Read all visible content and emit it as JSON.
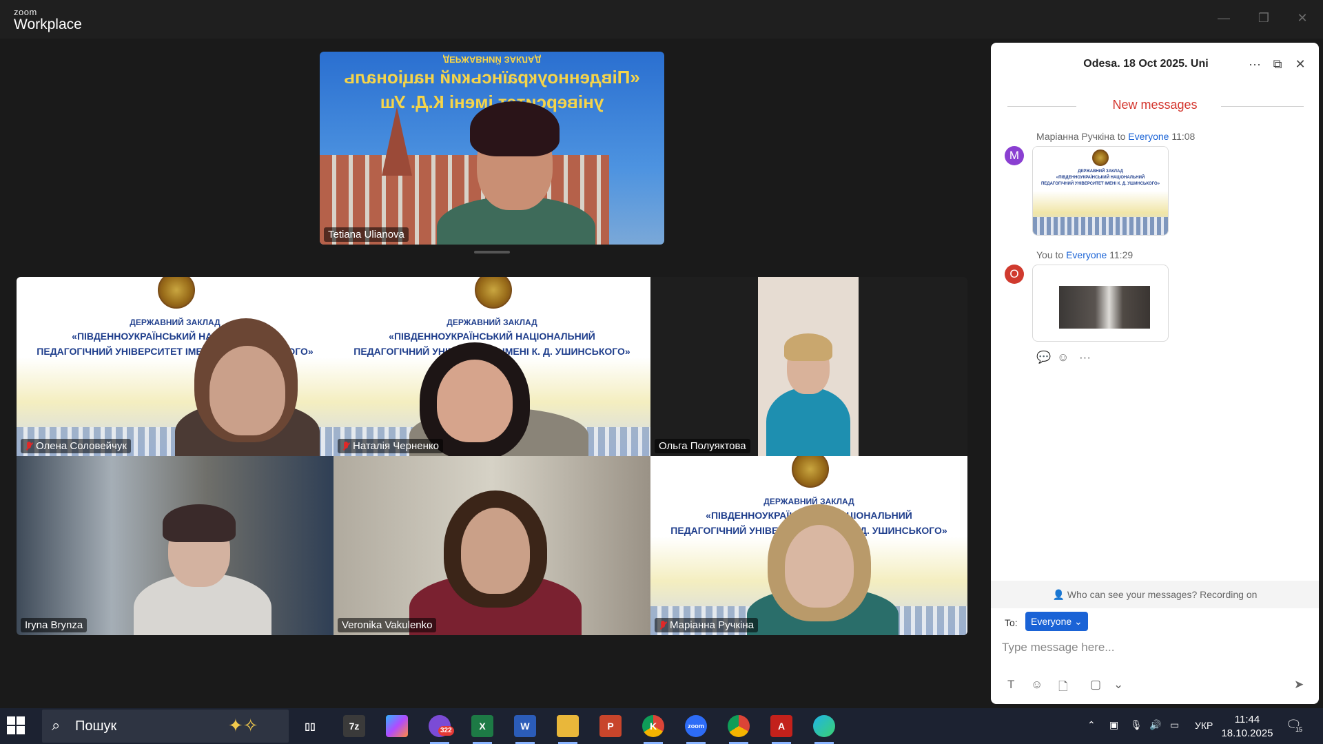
{
  "titlebar": {
    "brand_small": "zoom",
    "brand_large": "Workplace",
    "minimize": "—",
    "restore": "❐",
    "close": "✕"
  },
  "speaker": {
    "name": "Tetiana Ulianova",
    "banner_line1": "ДЕРЖАВНИЙ ЗАКЛАД",
    "banner_line2": "«Південноукраїнський національ",
    "banner_line3": "університет імені К.Д. Уш"
  },
  "gallery": {
    "banner_line1": "ДЕРЖАВНИЙ ЗАКЛАД",
    "banner_line2": "«ПІВДЕННОУКРАЇНСЬКИЙ НАЦІОНАЛЬНИЙ",
    "banner_line3": "ПЕДАГОГІЧНИЙ УНІВЕРСИТЕТ ІМЕНІ К. Д. УШИНСЬКОГО»",
    "tiles": [
      {
        "name": "Олена Соловейчук",
        "muted": true
      },
      {
        "name": "Наталія Черненко",
        "muted": true
      },
      {
        "name": "Ольга Полуяктова",
        "muted": false
      },
      {
        "name": "Iryna Brynza",
        "muted": false
      },
      {
        "name": "Veronika Vakulenko",
        "muted": false
      },
      {
        "name": "Маріанна Ручкіна",
        "muted": true
      }
    ]
  },
  "chat": {
    "title": "Odesa. 18 Oct 2025. Uni",
    "more_icon": "···",
    "popout_icon": "⧉",
    "close_icon": "✕",
    "new_messages": "New messages",
    "messages": [
      {
        "avatar_letter": "M",
        "avatar_color": "#8a3fd1",
        "sender": "Маріанна Ручкіна",
        "to_word": "to",
        "recipient": "Everyone",
        "time": "11:08"
      },
      {
        "avatar_letter": "O",
        "avatar_color": "#d03a2e",
        "sender": "You",
        "to_word": "to",
        "recipient": "Everyone",
        "time": "11:29"
      }
    ],
    "image_caption_line1": "ДЕРЖАВНИЙ ЗАКЛАД",
    "image_caption_line2": "«ПІВДЕННОУКРАЇНСЬКИЙ НАЦІОНАЛЬНИЙ",
    "image_caption_line3": "ПЕДАГОГІЧНИЙ УНІВЕРСИТЕТ ІМЕНІ К. Д. УШИНСЬКОГО»",
    "privacy_notice": "Who can see your messages? Recording on",
    "to_label": "To:",
    "to_value": "Everyone",
    "input_placeholder": "Type message here..."
  },
  "taskbar": {
    "search_text": "Пошук",
    "apps": [
      {
        "icon": "task-view-icon",
        "label": "▯▯"
      },
      {
        "icon": "7zip-icon",
        "label": "7z"
      },
      {
        "icon": "copilot-icon",
        "label": ""
      },
      {
        "icon": "viber-icon",
        "label": "",
        "badge": "322"
      },
      {
        "icon": "excel-icon",
        "label": "X"
      },
      {
        "icon": "word-icon",
        "label": "W"
      },
      {
        "icon": "file-explorer-icon",
        "label": ""
      },
      {
        "icon": "powerpoint-icon",
        "label": "P"
      },
      {
        "icon": "chrome-profile-icon",
        "label": "K"
      },
      {
        "icon": "zoom-icon",
        "label": "zoom"
      },
      {
        "icon": "chrome-icon",
        "label": ""
      },
      {
        "icon": "acrobat-icon",
        "label": "A"
      },
      {
        "icon": "edge-icon",
        "label": ""
      }
    ],
    "language": "УКР",
    "time": "11:44",
    "date": "18.10.2025",
    "notifications": "15"
  },
  "colors": {
    "chat_accent": "#1a63d6",
    "new_messages": "#d3332b",
    "muted_mic": "#e02828"
  }
}
